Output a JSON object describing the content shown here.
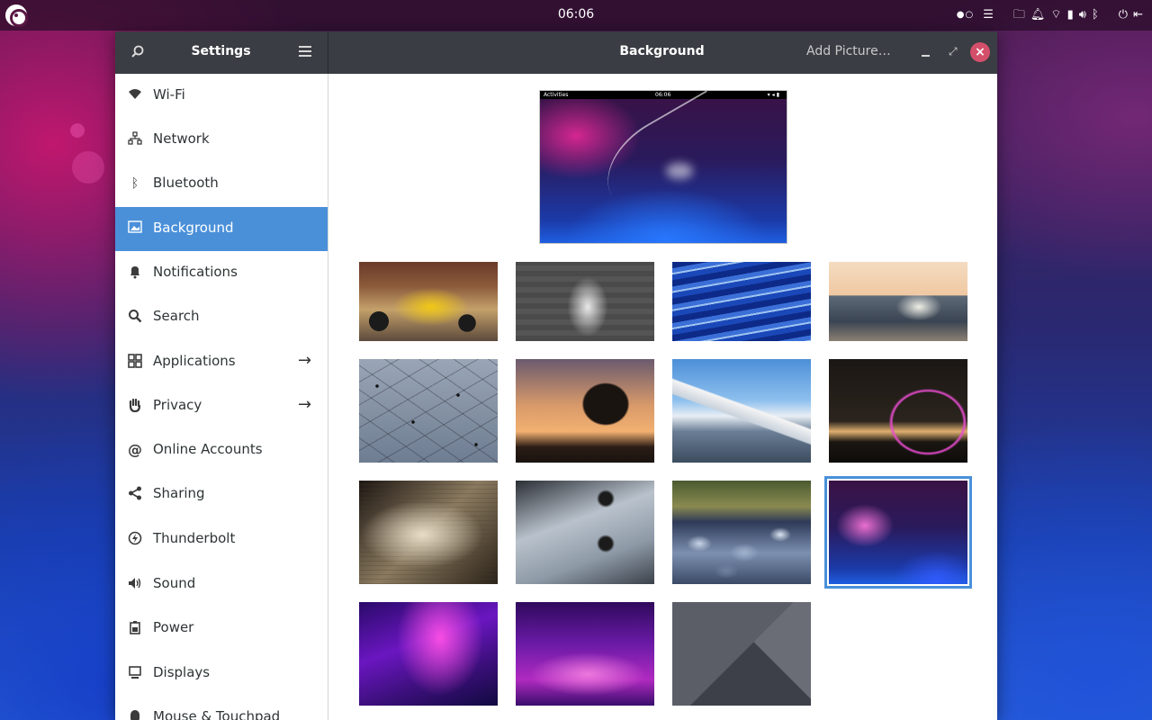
{
  "topbar": {
    "clock": "06:06",
    "tray_icons": [
      "workspace-dots-icon",
      "menu-icon",
      "files-icon",
      "bell-icon",
      "wifi-icon",
      "battery-icon",
      "volume-icon",
      "bluetooth-icon",
      "power-icon",
      "logout-icon"
    ]
  },
  "window": {
    "sidebar_title": "Settings",
    "title": "Background",
    "add_picture": "Add Picture…"
  },
  "sidebar": {
    "items": [
      {
        "label": "Wi-Fi",
        "icon": "wifi-icon"
      },
      {
        "label": "Network",
        "icon": "network-icon"
      },
      {
        "label": "Bluetooth",
        "icon": "bluetooth-icon"
      },
      {
        "label": "Background",
        "icon": "background-icon",
        "active": true
      },
      {
        "label": "Notifications",
        "icon": "bell-icon"
      },
      {
        "label": "Search",
        "icon": "search-icon"
      },
      {
        "label": "Applications",
        "icon": "apps-grid-icon",
        "has_submenu": true
      },
      {
        "label": "Privacy",
        "icon": "hand-icon",
        "has_submenu": true
      },
      {
        "label": "Online Accounts",
        "icon": "at-icon"
      },
      {
        "label": "Sharing",
        "icon": "share-icon"
      },
      {
        "label": "Thunderbolt",
        "icon": "thunderbolt-icon"
      },
      {
        "label": "Sound",
        "icon": "speaker-icon"
      },
      {
        "label": "Power",
        "icon": "power-battery-icon"
      },
      {
        "label": "Displays",
        "icon": "display-icon"
      },
      {
        "label": "Mouse & Touchpad",
        "icon": "mouse-icon"
      }
    ]
  },
  "preview": {
    "activities": "Activities",
    "clock": "06:06"
  },
  "wallpapers": [
    {
      "name": "yellow-scooter"
    },
    {
      "name": "statue"
    },
    {
      "name": "blue-waves"
    },
    {
      "name": "boat-at-sunset"
    },
    {
      "name": "water-drops"
    },
    {
      "name": "tree-silhouette"
    },
    {
      "name": "matterhorn-lake"
    },
    {
      "name": "pink-bridge-night"
    },
    {
      "name": "open-book"
    },
    {
      "name": "wooden-wall"
    },
    {
      "name": "pebbles"
    },
    {
      "name": "purple-blue-swoosh",
      "selected": true
    },
    {
      "name": "purple-aurora"
    },
    {
      "name": "purple-waves"
    },
    {
      "name": "grey-geometric"
    }
  ],
  "colors": {
    "accent": "#4a90d9",
    "headerbar": "#3a3d43",
    "close_button": "#d4506a"
  }
}
